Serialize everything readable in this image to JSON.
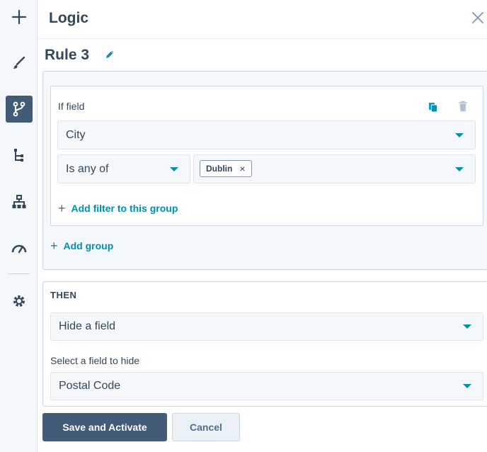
{
  "rail": {
    "items": [
      {
        "icon": "plus-icon"
      },
      {
        "icon": "brush-icon"
      },
      {
        "icon": "logic-branch-icon",
        "active": true
      },
      {
        "icon": "tree-icon"
      },
      {
        "icon": "sitemap-icon"
      },
      {
        "icon": "gauge-icon"
      },
      {
        "icon": "gear-icon"
      }
    ]
  },
  "header": {
    "title": "Logic"
  },
  "rule": {
    "title": "Rule 3"
  },
  "condition": {
    "if_label": "If field",
    "field_value": "City",
    "operator_value": "Is any of",
    "chip_label": "Dublin",
    "chip_remove": "×",
    "add_filter_label": "Add filter to this group",
    "add_group_label": "Add group"
  },
  "then": {
    "label": "THEN",
    "action_value": "Hide a field",
    "select_label": "Select a field to hide",
    "field_value": "Postal Code"
  },
  "footer": {
    "save_label": "Save and Activate",
    "cancel_label": "Cancel"
  },
  "colors": {
    "accent": "#0091ae",
    "primary_button": "#425b76",
    "text": "#33475b"
  }
}
